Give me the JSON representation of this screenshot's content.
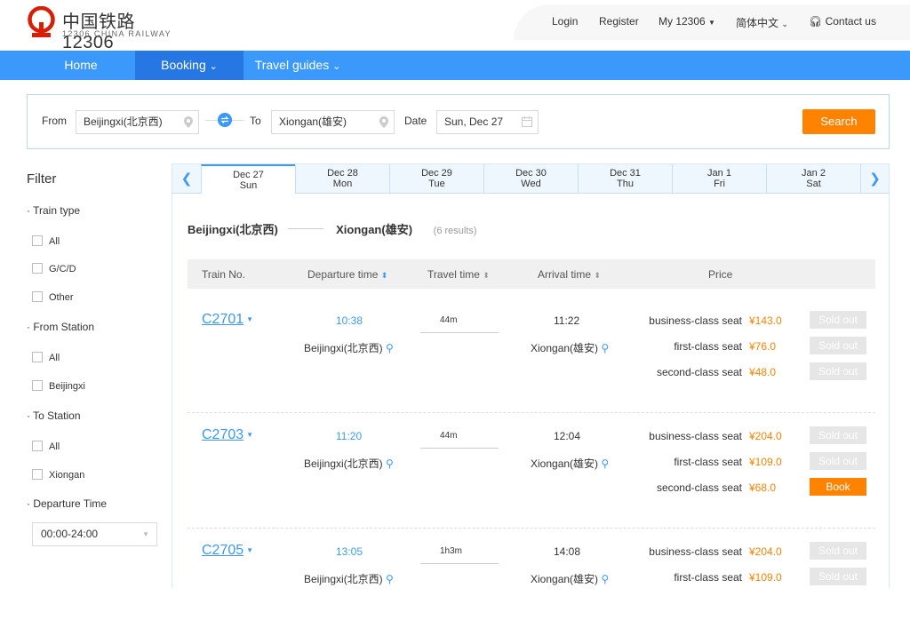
{
  "header": {
    "logo_title": "中国铁路12306",
    "logo_sub": "12306 CHINA RAILWAY",
    "nav": [
      "Login",
      "Register",
      "My 12306",
      "简体中文",
      "Contact us"
    ]
  },
  "navbar": {
    "home": "Home",
    "booking": "Booking",
    "travel": "Travel guides"
  },
  "search": {
    "from_label": "From",
    "from_value": "Beijingxi(北京西)",
    "to_label": "To",
    "to_value": "Xiongan(雄安)",
    "date_label": "Date",
    "date_value": "Sun, Dec 27",
    "button": "Search"
  },
  "filter": {
    "title": "Filter",
    "train_type": "Train type",
    "train_type_options": [
      "All",
      "G/C/D",
      "Other"
    ],
    "from_station": "From Station",
    "from_station_options": [
      "All",
      "Beijingxi"
    ],
    "to_station": "To Station",
    "to_station_options": [
      "All",
      "Xiongan"
    ],
    "departure_time": "Departure Time",
    "departure_value": "00:00-24:00"
  },
  "dates": [
    {
      "date": "Dec 27",
      "day": "Sun"
    },
    {
      "date": "Dec 28",
      "day": "Mon"
    },
    {
      "date": "Dec 29",
      "day": "Tue"
    },
    {
      "date": "Dec 30",
      "day": "Wed"
    },
    {
      "date": "Dec 31",
      "day": "Thu"
    },
    {
      "date": "Jan 1",
      "day": "Fri"
    },
    {
      "date": "Jan 2",
      "day": "Sat"
    }
  ],
  "route": {
    "from": "Beijingxi(北京西)",
    "to": "Xiongan(雄安)",
    "count": "(6 results)"
  },
  "table_headers": [
    "Train No.",
    "Departure time",
    "Travel time",
    "Arrival time",
    "Price"
  ],
  "trains": [
    {
      "no": "C2701",
      "dep": "10:38",
      "dur": "44m",
      "arr": "11:22",
      "from": "Beijingxi(北京西)",
      "to": "Xiongan(雄安)",
      "seats": [
        {
          "name": "business-class seat",
          "price": "¥143.0",
          "status": "Sold out"
        },
        {
          "name": "first-class seat",
          "price": "¥76.0",
          "status": "Sold out"
        },
        {
          "name": "second-class seat",
          "price": "¥48.0",
          "status": "Sold out"
        }
      ]
    },
    {
      "no": "C2703",
      "dep": "11:20",
      "dur": "44m",
      "arr": "12:04",
      "from": "Beijingxi(北京西)",
      "to": "Xiongan(雄安)",
      "seats": [
        {
          "name": "business-class seat",
          "price": "¥204.0",
          "status": "Sold out"
        },
        {
          "name": "first-class seat",
          "price": "¥109.0",
          "status": "Sold out"
        },
        {
          "name": "second-class seat",
          "price": "¥68.0",
          "status": "Book"
        }
      ]
    },
    {
      "no": "C2705",
      "dep": "13:05",
      "dur": "1h3m",
      "arr": "14:08",
      "from": "Beijingxi(北京西)",
      "to": "Xiongan(雄安)",
      "seats": [
        {
          "name": "business-class seat",
          "price": "¥204.0",
          "status": "Sold out"
        },
        {
          "name": "first-class seat",
          "price": "¥109.0",
          "status": "Sold out"
        }
      ]
    }
  ],
  "colors": {
    "brand_blue": "#3b99fc",
    "accent_orange": "#ff8200",
    "logo_red": "#d81e06"
  }
}
